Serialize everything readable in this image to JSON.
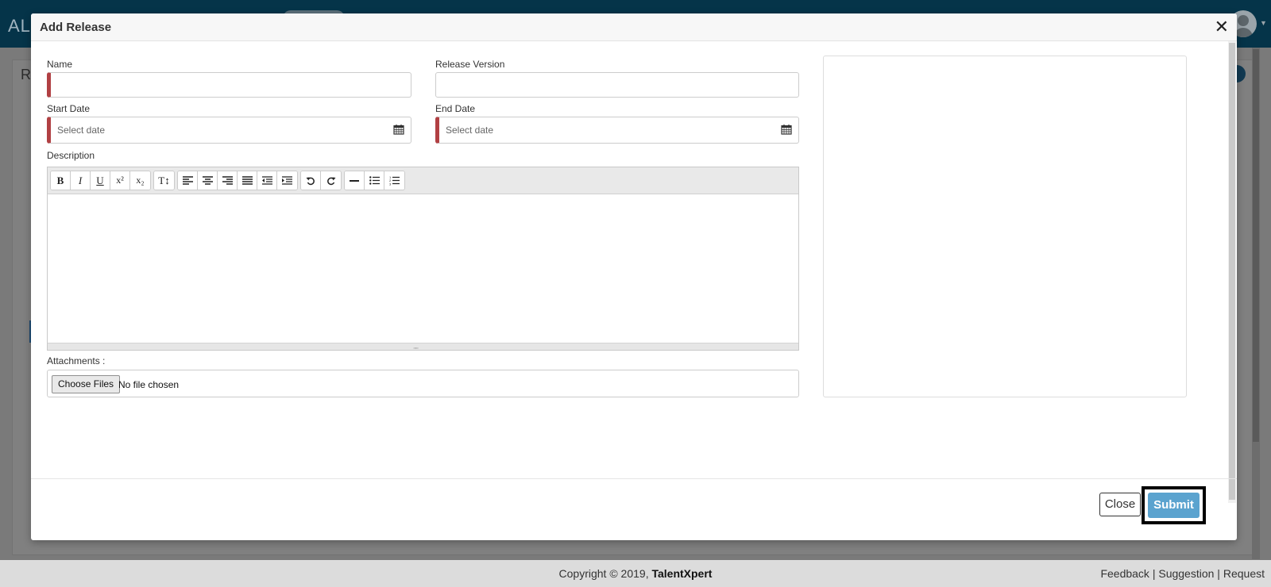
{
  "app": {
    "logo_text": "AL",
    "card_title": "R"
  },
  "modal": {
    "title": "Add Release",
    "close_glyph": "✕",
    "fields": {
      "name_label": "Name",
      "release_version_label": "Release Version",
      "start_date_label": "Start Date",
      "start_date_placeholder": "Select date",
      "end_date_label": "End Date",
      "end_date_placeholder": "Select date",
      "description_label": "Description",
      "attachments_label": "Attachments :",
      "choose_files_label": "Choose Files",
      "no_file_text": "No file chosen"
    },
    "toolbar": {
      "bold": "B",
      "italic": "I",
      "underline": "U",
      "superscript": "x²",
      "subscript": "x₂",
      "font_size": "T↕"
    },
    "footer": {
      "close_label": "Close",
      "submit_label": "Submit"
    }
  },
  "footer": {
    "copyright": "Copyright © 2019, ",
    "brand": "TalentXpert",
    "feedback": "Feedback",
    "suggestion": "Suggestion",
    "request": "Request",
    "separator": " | "
  },
  "colors": {
    "header_bg": "#053449",
    "required_marker": "#b14043",
    "submit_bg": "#5ba3cf"
  },
  "icons": [
    "calendar-icon",
    "close-icon",
    "align-left-icon",
    "align-center-icon",
    "align-right-icon",
    "justify-icon",
    "outdent-icon",
    "indent-icon",
    "undo-icon",
    "redo-icon",
    "horizontal-rule-icon",
    "bullet-list-icon",
    "numbered-list-icon"
  ]
}
